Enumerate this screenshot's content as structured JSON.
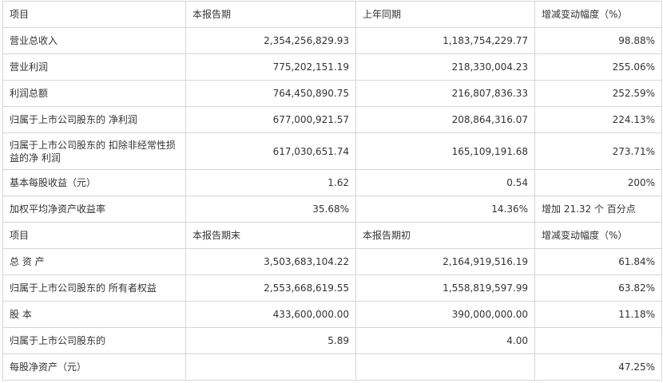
{
  "section1": {
    "header": [
      "项目",
      "本报告期",
      "上年同期",
      "增减变动幅度（%）"
    ],
    "rows": [
      {
        "label": "营业总收入",
        "current": "2,354,256,829.93",
        "previous": "1,183,754,229.77",
        "change": "98.88%"
      },
      {
        "label": "营业利润",
        "current": "775,202,151.19",
        "previous": "218,330,004.23",
        "change": "255.06%"
      },
      {
        "label": "利润总额",
        "current": "764,450,890.75",
        "previous": "216,807,836.33",
        "change": "252.59%"
      },
      {
        "label": "归属于上市公司股东的 净利润",
        "current": "677,000,921.57",
        "previous": "208,864,316.07",
        "change": "224.13%"
      },
      {
        "label": "归属于上市公司股东的 扣除非经常性损益的净 利润",
        "current": "617,030,651.74",
        "previous": "165,109,191.68",
        "change": "273.71%"
      },
      {
        "label": "基本每股收益（元）",
        "current": "1.62",
        "previous": "0.54",
        "change": "200%"
      },
      {
        "label": "加权平均净资产收益率",
        "current": "35.68%",
        "previous": "14.36%",
        "change": "增加 21.32 个 百分点"
      }
    ]
  },
  "section2": {
    "header": [
      "项目",
      "本报告期末",
      "本报告期初",
      "增减变动幅度（%）"
    ],
    "rows": [
      {
        "label": "总 资 产",
        "current": "3,503,683,104.22",
        "previous": "2,164,919,516.19",
        "change": "61.84%"
      },
      {
        "label": "归属于上市公司股东的 所有者权益",
        "current": "2,553,668,619.55",
        "previous": "1,558,819,597.99",
        "change": "63.82%"
      },
      {
        "label": "股 本",
        "current": "433,600,000.00",
        "previous": "390,000,000.00",
        "change": "11.18%"
      },
      {
        "label": "归属于上市公司股东的",
        "current": "5.89",
        "previous": "4.00",
        "change": ""
      },
      {
        "label": "每股净资产（元）",
        "current": "",
        "previous": "",
        "change": "47.25%"
      }
    ]
  }
}
